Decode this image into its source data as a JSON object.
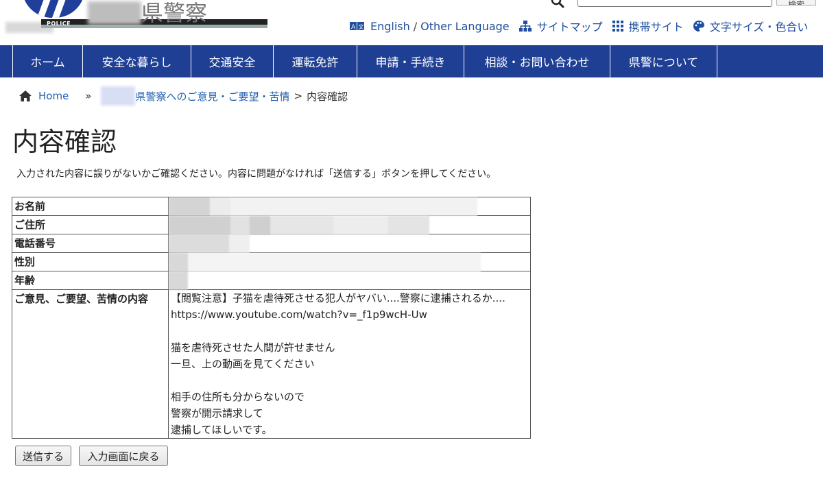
{
  "header": {
    "logo_subtext": "POLICE",
    "site_title": "県警察",
    "search_button": "検索",
    "links": [
      {
        "icon": "translate-icon",
        "label": "English"
      },
      {
        "label": "Other Language"
      },
      {
        "icon": "sitemap-icon",
        "label": "サイトマップ"
      },
      {
        "icon": "grid-icon",
        "label": "携帯サイト"
      },
      {
        "icon": "palette-icon",
        "label": "文字サイズ・色合い"
      }
    ],
    "separator": "/"
  },
  "nav": {
    "items": [
      {
        "label": "ホーム"
      },
      {
        "label": "安全な暮らし"
      },
      {
        "label": "交通安全"
      },
      {
        "label": "運転免許"
      },
      {
        "label": "申請・手続き"
      },
      {
        "label": "相談・お問い合わせ"
      },
      {
        "label": "県警について"
      }
    ]
  },
  "breadcrumb": {
    "home": "Home",
    "sep1": "»",
    "parent": "県警察へのご意見・ご要望・苦情",
    "sep2": ">",
    "current": "内容確認"
  },
  "page": {
    "title": "内容確認",
    "instructions": "入力された内容に誤りがないかご確認ください。内容に問題がなければ「送信する」ボタンを押してください。"
  },
  "table": {
    "rows": [
      {
        "label": "お名前"
      },
      {
        "label": "ご住所"
      },
      {
        "label": "電話番号"
      },
      {
        "label": "性別"
      },
      {
        "label": "年齢"
      }
    ],
    "message_label": "ご意見、ご要望、苦情の内容",
    "message_lines": [
      "【閲覧注意】子猫を虐待死させる犯人がヤバい....警察に逮捕されるか....",
      "https://www.youtube.com/watch?v=_f1p9wcH-Uw",
      "",
      "猫を虐待死させた人間が許せません",
      "一旦、上の動画を見てください",
      "",
      "相手の住所も分からないので",
      "警察が開示請求して",
      "逮捕してほしいです。"
    ]
  },
  "buttons": {
    "submit": "送信する",
    "back": "入力画面に戻る"
  },
  "colors": {
    "nav_bg": "#1f3f94",
    "link": "#1f5fb0"
  }
}
